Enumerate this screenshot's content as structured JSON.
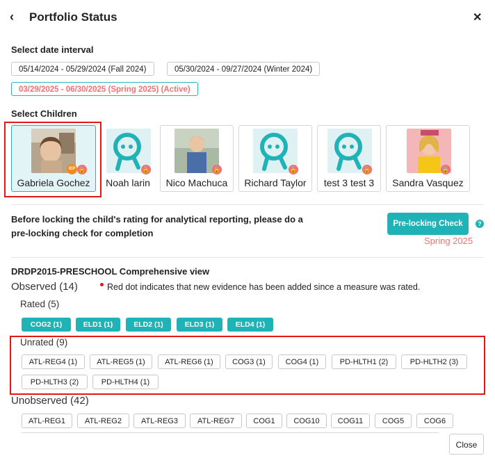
{
  "header": {
    "back_icon": "chevron-left-icon",
    "title": "Portfolio Status",
    "close_icon": "close-icon"
  },
  "date_section": {
    "label": "Select date interval",
    "intervals": [
      "05/14/2024 - 05/29/2024 (Fall 2024)",
      "05/30/2024 - 09/27/2024 (Winter 2024)",
      "03/29/2025 - 06/30/2025 (Spring 2025) (Active)"
    ],
    "active_index": 2
  },
  "children_section": {
    "label": "Select Children",
    "children": [
      {
        "name": "Gabriela Gochez",
        "avatar": "photo",
        "badges": [
          "IEP",
          "lock"
        ],
        "selected": true
      },
      {
        "name": "Noah larin",
        "avatar": "default-robot-avatar",
        "badges": [
          "lock"
        ],
        "selected": false
      },
      {
        "name": "Nico Machuca",
        "avatar": "photo",
        "badges": [
          "lock"
        ],
        "selected": false
      },
      {
        "name": "Richard Taylor",
        "avatar": "default-robot-avatar",
        "badges": [
          "lock"
        ],
        "selected": false
      },
      {
        "name": "test 3 test 3",
        "avatar": "default-robot-avatar",
        "badges": [
          "lock"
        ],
        "selected": false
      },
      {
        "name": "Sandra Vasquez",
        "avatar": "photo",
        "badges": [
          "lock"
        ],
        "selected": false
      }
    ],
    "iep_badge": "IEP"
  },
  "lock_notice": {
    "text_line1": "Before locking the child's rating for analytical reporting, please do a",
    "text_line2": "pre-locking check for completion",
    "button_label": "Pre-locking Check",
    "help_icon": "help-icon",
    "help_glyph": "?",
    "term": "Spring 2025"
  },
  "view": {
    "title": "DRDP2015-PRESCHOOL Comprehensive view",
    "observed_label": "Observed (14)",
    "red_dot_note": "Red dot indicates that new evidence has been added since a measure was rated.",
    "rated_label": "Rated (5)",
    "rated": [
      "COG2 (1)",
      "ELD1 (1)",
      "ELD2 (1)",
      "ELD3 (1)",
      "ELD4 (1)"
    ],
    "unrated_label": "Unrated (9)",
    "unrated": [
      "ATL-REG4 (1)",
      "ATL-REG5 (1)",
      "ATL-REG6 (1)",
      "COG3 (1)",
      "COG4 (1)",
      "PD-HLTH1 (2)",
      "PD-HLTH2 (3)",
      "PD-HLTH3 (2)",
      "PD-HLTH4 (1)"
    ],
    "unobserved_label": "Unobserved (42)",
    "unobserved": [
      "ATL-REG1",
      "ATL-REG2",
      "ATL-REG3",
      "ATL-REG7",
      "COG1",
      "COG10",
      "COG11",
      "COG5",
      "COG6"
    ]
  },
  "footer": {
    "close_label": "Close"
  },
  "colors": {
    "accent": "#1fb3b7",
    "highlight_red": "#f07272",
    "frame_red": "#e01818",
    "iep_orange": "#f08a1e"
  }
}
